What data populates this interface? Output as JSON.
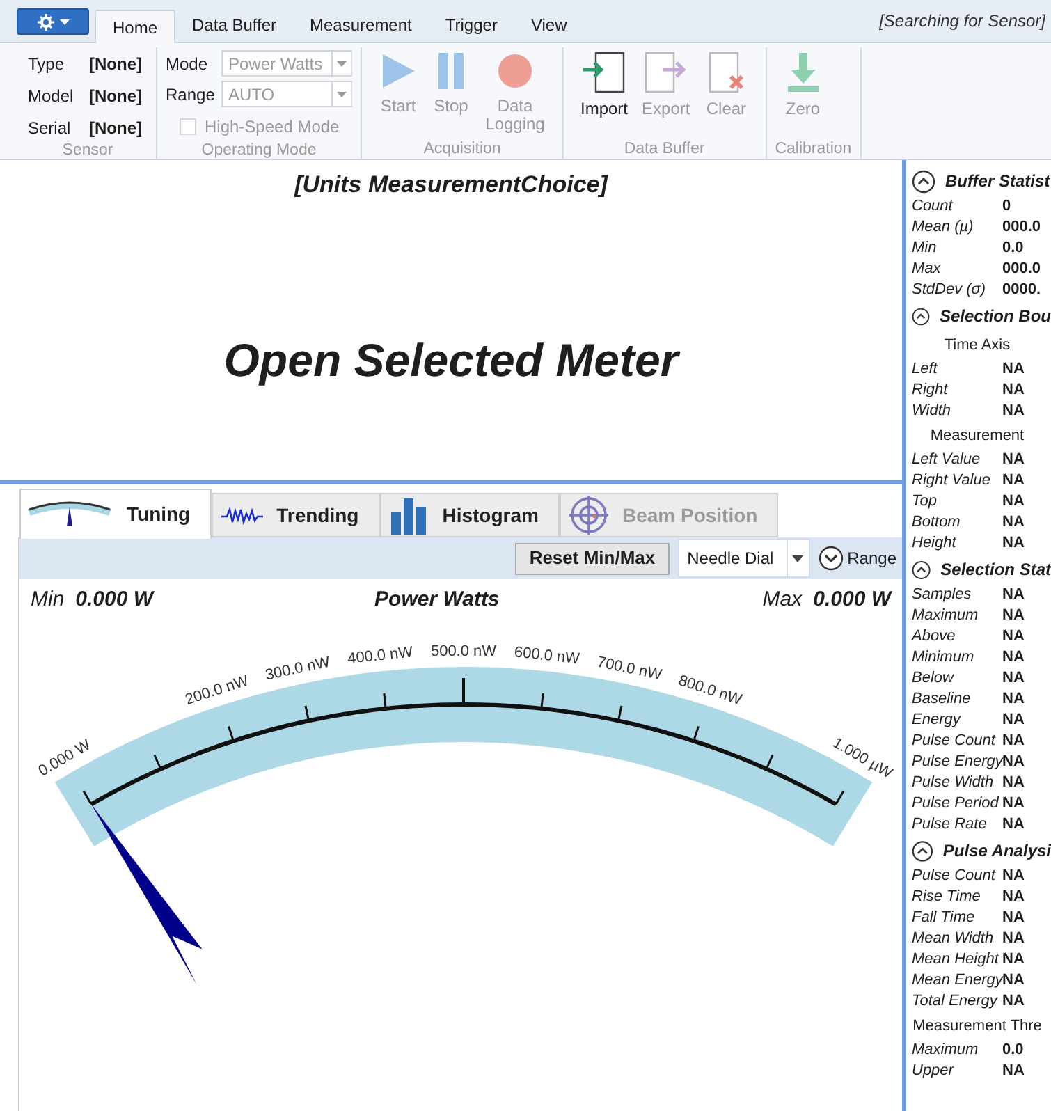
{
  "ribbon": {
    "tabs": [
      {
        "label": "Home",
        "selected": true
      },
      {
        "label": "Data Buffer",
        "selected": false
      },
      {
        "label": "Measurement",
        "selected": false
      },
      {
        "label": "Trigger",
        "selected": false
      },
      {
        "label": "View",
        "selected": false
      }
    ],
    "status": "[Searching for Sensor]",
    "groups": [
      {
        "kind": "fields",
        "title": "Sensor",
        "fields": [
          {
            "label": "Type",
            "value": "[None]"
          },
          {
            "label": "Model",
            "value": "[None]"
          },
          {
            "label": "Serial",
            "value": "[None]"
          }
        ]
      },
      {
        "kind": "operating",
        "title": "Operating Mode",
        "dropdowns": [
          {
            "label": "Mode",
            "value": "Power Watts",
            "disabled": true
          },
          {
            "label": "Range",
            "value": "AUTO",
            "disabled": true
          }
        ],
        "checkbox": {
          "label": "High-Speed Mode",
          "checked": false,
          "disabled": true
        }
      },
      {
        "kind": "buttons",
        "title": "Acquisition",
        "buttons": [
          {
            "kind": "start",
            "label": "Start",
            "disabled": true
          },
          {
            "kind": "stop",
            "label": "Stop",
            "disabled": true
          },
          {
            "kind": "record",
            "label": "Data Logging",
            "disabled": true
          }
        ]
      },
      {
        "kind": "buttons",
        "title": "Data Buffer",
        "buttons": [
          {
            "kind": "import",
            "label": "Import",
            "disabled": false
          },
          {
            "kind": "export",
            "label": "Export",
            "disabled": true
          },
          {
            "kind": "clear",
            "label": "Clear",
            "disabled": true
          }
        ]
      },
      {
        "kind": "buttons",
        "title": "Calibration",
        "buttons": [
          {
            "kind": "zero",
            "label": "Zero",
            "disabled": true
          }
        ]
      }
    ]
  },
  "meter_title": "[Units MeasurementChoice]",
  "message": "Open Selected Meter",
  "view_tabs": [
    {
      "kind": "tuning",
      "label": "Tuning",
      "selected": true,
      "disabled": false
    },
    {
      "kind": "trending",
      "label": "Trending",
      "selected": false,
      "disabled": false
    },
    {
      "kind": "histogram",
      "label": "Histogram",
      "selected": false,
      "disabled": false
    },
    {
      "kind": "beam",
      "label": "Beam Position",
      "selected": false,
      "disabled": true
    }
  ],
  "toolbar": {
    "reset_button": "Reset Min/Max",
    "display": "Needle Dial",
    "range": {
      "label": "Range",
      "expanded": false
    }
  },
  "readout": {
    "min_label": "Min",
    "min_value": "0.000 W",
    "title": "Power Watts",
    "max_label": "Max",
    "max_value": "0.000 W"
  },
  "gauge": {
    "ticks": [
      {
        "kind": "labelled",
        "label": "0.000 W"
      },
      {
        "kind": "plain"
      },
      {
        "kind": "labelled",
        "label": "200.0 nW"
      },
      {
        "kind": "labelled",
        "label": "300.0 nW"
      },
      {
        "kind": "labelled",
        "label": "400.0 nW"
      },
      {
        "kind": "labelled",
        "label": "500.0 nW"
      },
      {
        "kind": "labelled",
        "label": "600.0 nW"
      },
      {
        "kind": "labelled",
        "label": "700.0 nW"
      },
      {
        "kind": "labelled",
        "label": "800.0 nW"
      },
      {
        "kind": "plain"
      },
      {
        "kind": "labelled",
        "label": "1.000 µW"
      }
    ]
  },
  "stats_panel": {
    "sections": [
      {
        "title": "Buffer Statist",
        "expanded": true,
        "items": [
          {
            "kind": "row",
            "label": "Count",
            "value": "0"
          },
          {
            "kind": "row",
            "label": "Mean (µ)",
            "value": "000.0"
          },
          {
            "kind": "row",
            "label": "Min",
            "value": "0.0"
          },
          {
            "kind": "row",
            "label": "Max",
            "value": "000.0"
          },
          {
            "kind": "row",
            "label": "StdDev (σ)",
            "value": "0000."
          }
        ]
      },
      {
        "title": "Selection Bou",
        "expanded": true,
        "items": [
          {
            "kind": "subheader",
            "text": "Time Axis"
          },
          {
            "kind": "row",
            "label": "Left",
            "value": "NA"
          },
          {
            "kind": "row",
            "label": "Right",
            "value": "NA"
          },
          {
            "kind": "row",
            "label": "Width",
            "value": "NA"
          },
          {
            "kind": "subheader",
            "text": "Measurement"
          },
          {
            "kind": "row",
            "label": "Left Value",
            "value": "NA"
          },
          {
            "kind": "row",
            "label": "Right Value",
            "value": "NA"
          },
          {
            "kind": "row",
            "label": "Top",
            "value": "NA"
          },
          {
            "kind": "row",
            "label": "Bottom",
            "value": "NA"
          },
          {
            "kind": "row",
            "label": "Height",
            "value": "NA"
          }
        ]
      },
      {
        "title": "Selection Stat",
        "expanded": true,
        "items": [
          {
            "kind": "row",
            "label": "Samples",
            "value": "NA"
          },
          {
            "kind": "row",
            "label": "Maximum",
            "value": "NA"
          },
          {
            "kind": "row",
            "label": "Above",
            "value": "NA"
          },
          {
            "kind": "row",
            "label": "Minimum",
            "value": "NA"
          },
          {
            "kind": "row",
            "label": "Below",
            "value": "NA"
          },
          {
            "kind": "row",
            "label": "Baseline",
            "value": "NA"
          },
          {
            "kind": "row",
            "label": "Energy",
            "value": "NA"
          },
          {
            "kind": "row",
            "label": "Pulse Count",
            "value": "NA"
          },
          {
            "kind": "row",
            "label": "Pulse Energy",
            "value": "NA"
          },
          {
            "kind": "row",
            "label": "Pulse Width",
            "value": "NA"
          },
          {
            "kind": "row",
            "label": "Pulse Period",
            "value": "NA"
          },
          {
            "kind": "row",
            "label": "Pulse Rate",
            "value": "NA"
          }
        ]
      },
      {
        "title": "Pulse Analysi",
        "expanded": true,
        "items": [
          {
            "kind": "row",
            "label": "Pulse Count",
            "value": "NA"
          },
          {
            "kind": "row",
            "label": "Rise Time",
            "value": "NA"
          },
          {
            "kind": "row",
            "label": "Fall Time",
            "value": "NA"
          },
          {
            "kind": "row",
            "label": "Mean Width",
            "value": "NA"
          },
          {
            "kind": "row",
            "label": "Mean Height",
            "value": "NA"
          },
          {
            "kind": "row",
            "label": "Mean Energy",
            "value": "NA"
          },
          {
            "kind": "row",
            "label": "Total Energy",
            "value": "NA"
          },
          {
            "kind": "subheader",
            "text": "Measurement Thre"
          },
          {
            "kind": "row",
            "label": "Maximum",
            "value": "0.0"
          },
          {
            "kind": "row",
            "label": "Upper",
            "value": "NA"
          }
        ]
      }
    ]
  }
}
